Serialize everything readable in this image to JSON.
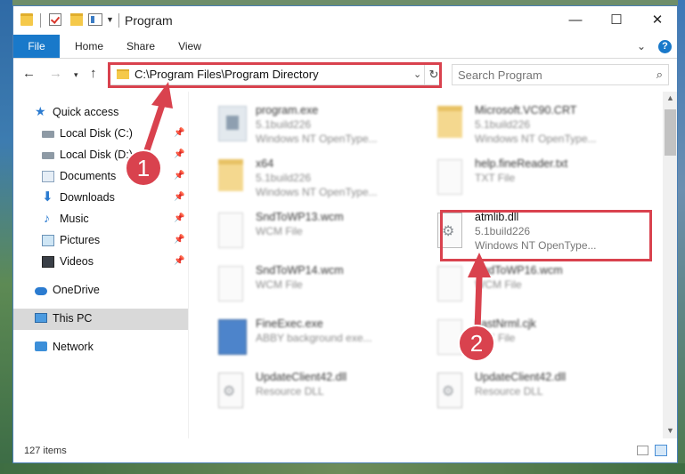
{
  "window": {
    "title": "Program",
    "controls": {
      "minimize": "—",
      "maximize": "☐",
      "close": "✕"
    }
  },
  "ribbon": {
    "tabs": [
      "File",
      "Home",
      "Share",
      "View"
    ],
    "expand_icon": "chevron-down-icon",
    "help_label": "?"
  },
  "nav": {
    "back": "←",
    "forward": "→",
    "recent": "▾",
    "up": "↑",
    "address": "C:\\Program Files\\Program Directory",
    "address_dropdown": "⌄",
    "refresh": "↻",
    "search_placeholder": "Search Program",
    "search_icon": "⌕"
  },
  "sidebar": {
    "items": [
      {
        "label": "Quick access",
        "icon": "star-icon",
        "pinned": false
      },
      {
        "label": "Local Disk (C:)",
        "icon": "disk-icon",
        "pinned": true
      },
      {
        "label": "Local Disk (D:)",
        "icon": "disk-icon",
        "pinned": true
      },
      {
        "label": "Documents",
        "icon": "documents-icon",
        "pinned": true
      },
      {
        "label": "Downloads",
        "icon": "downloads-icon",
        "pinned": true
      },
      {
        "label": "Music",
        "icon": "music-icon",
        "pinned": true
      },
      {
        "label": "Pictures",
        "icon": "pictures-icon",
        "pinned": true
      },
      {
        "label": "Videos",
        "icon": "videos-icon",
        "pinned": true
      },
      {
        "label": "OneDrive",
        "icon": "onedrive-icon",
        "pinned": false
      },
      {
        "label": "This PC",
        "icon": "this-pc-icon",
        "pinned": false,
        "selected": true
      },
      {
        "label": "Network",
        "icon": "network-icon",
        "pinned": false
      }
    ],
    "pin_glyph": "📌",
    "star_glyph": "★",
    "download_glyph": "⬇",
    "music_glyph": "♪"
  },
  "files": [
    {
      "name": "program.exe",
      "line1": "5.1build226",
      "line2": "Windows NT OpenType...",
      "icon": "exe-icon",
      "blurred": true
    },
    {
      "name": "Microsoft.VC90.CRT",
      "line1": "5.1build226",
      "line2": "Windows NT OpenType...",
      "icon": "folder-icon",
      "blurred": true
    },
    {
      "name": "x64",
      "line1": "5.1build226",
      "line2": "Windows NT OpenType...",
      "icon": "folder-icon",
      "blurred": true
    },
    {
      "name": "help.fineReader.txt",
      "line1": "TXT File",
      "line2": "",
      "icon": "document-icon",
      "blurred": true
    },
    {
      "name": "SndToWP13.wcm",
      "line1": "WCM File",
      "line2": "",
      "icon": "document-icon",
      "blurred": true
    },
    {
      "name": "atmlib.dll",
      "line1": "5.1build226",
      "line2": "Windows NT OpenType...",
      "icon": "dll-icon",
      "blurred": false
    },
    {
      "name": "SndToWP14.wcm",
      "line1": "WCM File",
      "line2": "",
      "icon": "document-icon",
      "blurred": true
    },
    {
      "name": "SndToWP16.wcm",
      "line1": "WCM File",
      "line2": "",
      "icon": "document-icon",
      "blurred": true
    },
    {
      "name": "FineExec.exe",
      "line1": "ABBY background exe...",
      "line2": "",
      "icon": "app-icon",
      "blurred": true
    },
    {
      "name": "LastNrml.cjk",
      "line1": "CJK File",
      "line2": "",
      "icon": "document-icon",
      "blurred": true
    },
    {
      "name": "UpdateClient42.dll",
      "line1": "Resource DLL",
      "line2": "",
      "icon": "dll-icon",
      "blurred": true
    },
    {
      "name": "UpdateClient42.dll",
      "line1": "Resource DLL",
      "line2": "",
      "icon": "dll-icon",
      "blurred": true
    }
  ],
  "status": {
    "count": "127 items"
  },
  "annotations": [
    {
      "label": "1",
      "color": "#d9424e"
    },
    {
      "label": "2",
      "color": "#d9424e"
    }
  ],
  "colors": {
    "accent": "#1979ca",
    "annotation": "#d9424e"
  }
}
